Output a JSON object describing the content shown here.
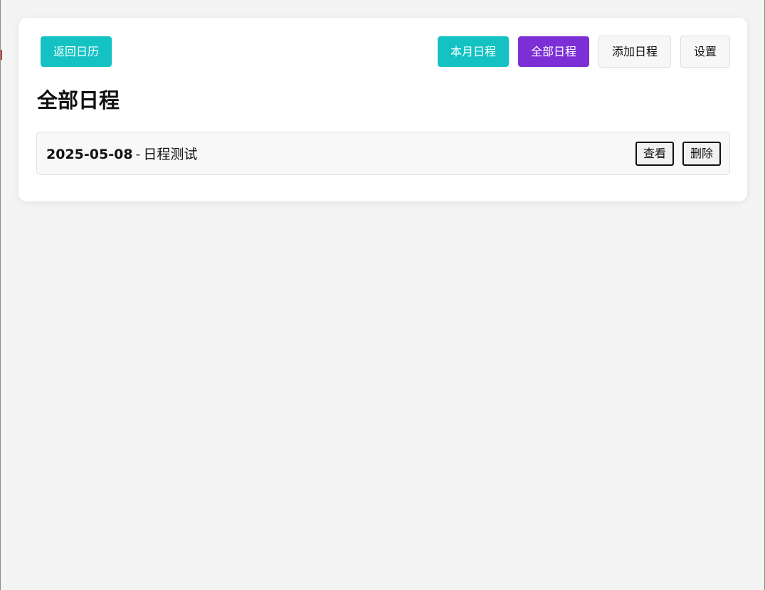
{
  "toolbar": {
    "back_label": "返回日历",
    "month_label": "本月日程",
    "all_label": "全部日程",
    "add_label": "添加日程",
    "settings_label": "设置"
  },
  "page": {
    "title": "全部日程"
  },
  "events": [
    {
      "date": "2025-05-08",
      "separator": "-",
      "title": "日程测试",
      "view_label": "查看",
      "delete_label": "删除"
    }
  ],
  "colors": {
    "teal": "#14c2c3",
    "purple": "#7b2fd4",
    "background": "#f4f4f4"
  }
}
